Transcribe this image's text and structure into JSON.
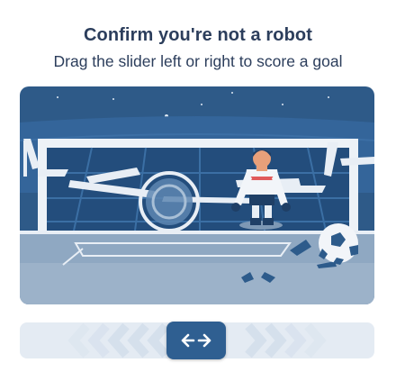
{
  "captcha": {
    "title": "Confirm you're not a robot",
    "instruction": "Drag the slider left or right to score a goal"
  },
  "scene": {
    "elements": [
      "night-sky",
      "goal-net",
      "goalkeeper",
      "soccer-ball",
      "target-ring",
      "pitch-lines"
    ]
  },
  "slider": {
    "handle_icon": "left-right-arrows-icon",
    "track_pattern": "chevron-arrows"
  },
  "colors": {
    "text": "#2c3e5c",
    "accent": "#2f5f91",
    "track": "#e4ebf3"
  }
}
